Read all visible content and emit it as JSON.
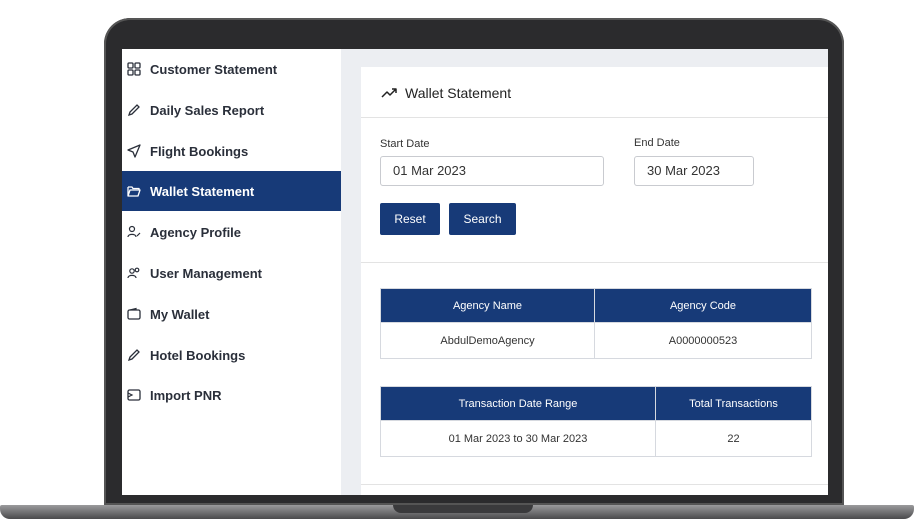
{
  "sidebar": {
    "items": [
      {
        "label": "Customer Statement",
        "icon": "grid-icon"
      },
      {
        "label": "Daily Sales Report",
        "icon": "pencil-icon"
      },
      {
        "label": "Flight Bookings",
        "icon": "send-icon"
      },
      {
        "label": "Wallet Statement",
        "icon": "folder-open-icon",
        "active": true
      },
      {
        "label": "Agency Profile",
        "icon": "user-edit-icon"
      },
      {
        "label": "User Management",
        "icon": "users-icon"
      },
      {
        "label": "My Wallet",
        "icon": "wallet-icon"
      },
      {
        "label": "Hotel Bookings",
        "icon": "pencil-icon"
      },
      {
        "label": "Import PNR",
        "icon": "import-icon"
      }
    ]
  },
  "main": {
    "title": "Wallet Statement",
    "title_icon": "trending-up-icon",
    "start_date_label": "Start Date",
    "start_date_value": "01 Mar 2023",
    "end_date_label": "End Date",
    "end_date_value": "30 Mar 2023",
    "reset_label": "Reset",
    "search_label": "Search",
    "agency_table": {
      "headers": [
        "Agency Name",
        "Agency Code"
      ],
      "row": [
        "AbdulDemoAgency",
        "A0000000523"
      ]
    },
    "transaction_table": {
      "headers": [
        "Transaction Date Range",
        "Total Transactions"
      ],
      "row": [
        "01 Mar 2023 to 30 Mar 2023",
        "22"
      ]
    }
  },
  "colors": {
    "accent": "#173a78",
    "frame": "#2b2b2d",
    "background": "#eceef2"
  }
}
